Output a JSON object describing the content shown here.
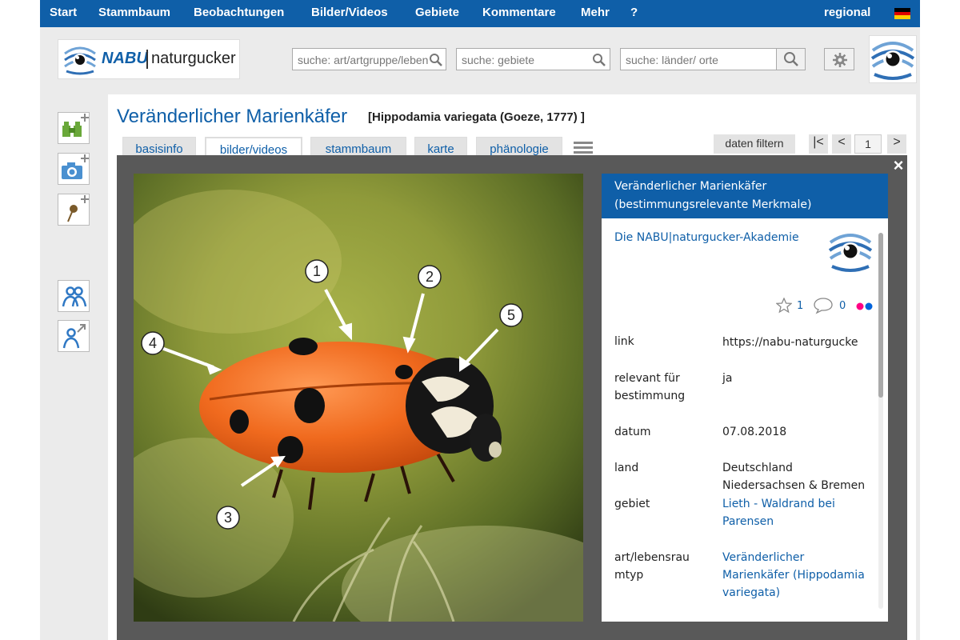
{
  "nav": {
    "items": [
      "Start",
      "Stammbaum",
      "Beobachtungen",
      "Bilder/Videos",
      "Gebiete",
      "Kommentare",
      "Mehr",
      "?"
    ],
    "regional": "regional",
    "flag": "de-flag"
  },
  "header": {
    "logo_nabu": "NABU",
    "logo_naturgucker": "naturgucker",
    "search_art": "suche: art/artgruppe/leben",
    "search_gebiete": "suche: gebiete",
    "search_orte": "suche: länder/ orte"
  },
  "sidebar": {
    "icons": [
      "binoculars-add-icon",
      "camera-add-icon",
      "pin-add-icon",
      "group-icon",
      "user-share-icon"
    ]
  },
  "species": {
    "title": "Veränderlicher Marienkäfer",
    "scientific": "[Hippodamia variegata (Goeze, 1777) ]"
  },
  "tabs": [
    "basisinfo",
    "bilder/videos",
    "stammbaum",
    "karte",
    "phänologie"
  ],
  "active_tab": "bilder/videos",
  "toolbar": {
    "filter": "daten filtern",
    "first": "|<",
    "prev": "<",
    "page": "1",
    "next": ">"
  },
  "lightbox": {
    "close": "×",
    "photo_callouts": [
      "1",
      "2",
      "3",
      "4",
      "5"
    ],
    "header_line1": "Veränderlicher Marienkäfer",
    "header_line2": "(bestimmungsrelevante Merkmale)",
    "author": "Die NABU|naturgucker-Akademie",
    "likes": "1",
    "comments": "0",
    "link_label": "link",
    "link_value": "https://nabu-naturgucker.de",
    "relevant_label_1": "relevant für",
    "relevant_label_2": "bestimmung",
    "relevant_value": "ja",
    "datum_label": "datum",
    "datum_value": "07.08.2018",
    "land_label": "land",
    "land_value": "Deutschland",
    "region_value": "Niedersachsen & Bremen",
    "gebiet_label": "gebiet",
    "gebiet_value_1": "Lieth - Waldrand bei",
    "gebiet_value_2": "Parensen",
    "art_label_1": "art/lebensrau",
    "art_label_2": "mtyp",
    "art_value_1": "Veränderlicher",
    "art_value_2": "Marienkäfer (Hippodamia",
    "art_value_3": "variegata)"
  },
  "colors": {
    "brand_blue": "#0f5fa8",
    "flickr_pink": "#ff0084",
    "flickr_blue": "#0063dc"
  }
}
